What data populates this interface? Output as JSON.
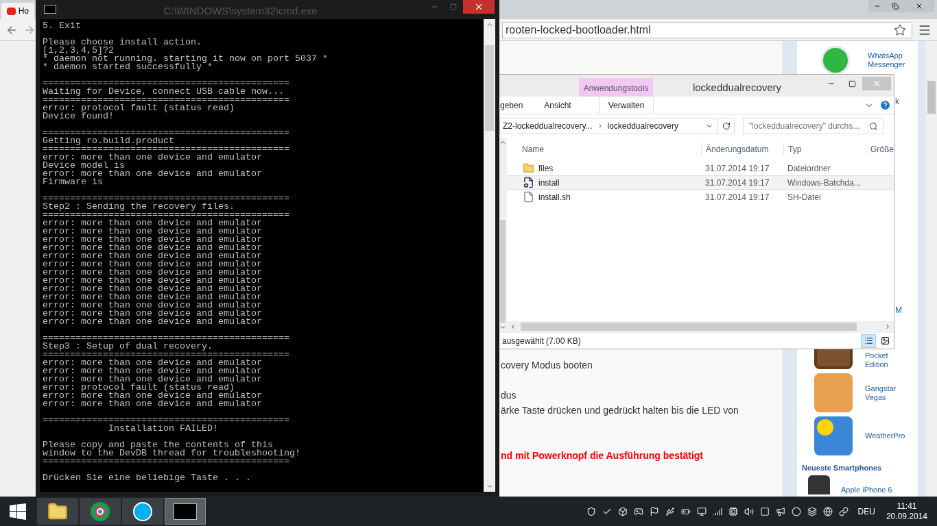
{
  "browser": {
    "tab": {
      "title": "Ho"
    },
    "url": "rooten-locked-bootloader.html",
    "article_lines": [
      {
        "text": "covery Modus booten",
        "kind": "normal"
      },
      {
        "text": "dus",
        "kind": "normal"
      },
      {
        "text": "ärke Taste drücken und gedrückt halten bis die LED von",
        "kind": "normal"
      },
      {
        "text": "nd mit Powerknopf die Ausführung bestätigt",
        "kind": "warning"
      }
    ],
    "sidebar": {
      "top_app": {
        "name": "WhatsApp Messenger"
      },
      "partial_labels": [
        "k",
        "M"
      ],
      "apps": [
        {
          "name": "Pocket Edition",
          "kind": "blocks"
        },
        {
          "name": "Gangstar Vegas",
          "kind": "photo"
        },
        {
          "name": "WeatherPro",
          "kind": "weather"
        }
      ],
      "heading": "Neueste Smartphones",
      "phones": [
        {
          "name": "Apple iPhone 6"
        }
      ]
    }
  },
  "console": {
    "title": "C:\\WINDOWS\\system32\\cmd.exe",
    "blocks": [
      [
        "5. Exit"
      ],
      [
        "Please choose install action.",
        "[1,2,3,4,5]?2",
        "* daemon not running. starting it now on port 5037 *",
        "* daemon started successfully *"
      ],
      [
        "=============================================",
        "Waiting for Device, connect USB cable now...",
        "=============================================",
        "error: protocol fault (status read)",
        "Device found!"
      ],
      [
        "=============================================",
        "Getting ro.build.product",
        "=============================================",
        "error: more than one device and emulator",
        "Device model is",
        "error: more than one device and emulator",
        "Firmware is"
      ],
      [
        "=============================================",
        "Step2 : Sending the recovery files.",
        "=============================================",
        "error: more than one device and emulator",
        "error: more than one device and emulator",
        "error: more than one device and emulator",
        "error: more than one device and emulator",
        "error: more than one device and emulator",
        "error: more than one device and emulator",
        "error: more than one device and emulator",
        "error: more than one device and emulator",
        "error: more than one device and emulator",
        "error: more than one device and emulator",
        "error: more than one device and emulator",
        "error: more than one device and emulator",
        "error: more than one device and emulator"
      ],
      [
        "=============================================",
        "Step3 : Setup of dual recovery.",
        "=============================================",
        "error: more than one device and emulator",
        "error: more than one device and emulator",
        "error: more than one device and emulator",
        "error: protocol fault (status read)",
        "error: more than one device and emulator",
        "error: more than one device and emulator"
      ],
      [
        "=============================================",
        "            Installation FAILED!"
      ],
      [
        "Please copy and paste the contents of this",
        "window to the DevDB thread for troubleshooting!",
        "============================================="
      ],
      [
        "Drücken Sie eine beliebige Taste . . ."
      ]
    ]
  },
  "explorer": {
    "context_tab": "Anwendungstools",
    "title": "lockeddualrecovery",
    "ribbon_tabs": [
      {
        "label": "geben",
        "selected": false
      },
      {
        "label": "Ansicht",
        "selected": false
      },
      {
        "label": "Verwalten",
        "selected": false
      }
    ],
    "breadcrumb": [
      "Z2-lockeddualrecovery...",
      "lockeddualrecovery"
    ],
    "search": {
      "placeholder": "\"lockeddualrecovery\" durchs..."
    },
    "columns": [
      "Name",
      "Änderungsdatum",
      "Typ",
      "Größe"
    ],
    "rows": [
      {
        "name": "files",
        "kind": "folder",
        "date": "31.07.2014 19:17",
        "type": "Dateiordner",
        "selected": false
      },
      {
        "name": "install",
        "kind": "batch",
        "date": "31.07.2014 19:17",
        "type": "Windows-Batchda...",
        "selected": true
      },
      {
        "name": "install.sh",
        "kind": "file",
        "date": "31.07.2014 19:17",
        "type": "SH-Datei",
        "selected": false
      }
    ],
    "status": "ausgewählt (7.00 KB)",
    "views": [
      {
        "kind": "details",
        "selected": true
      },
      {
        "kind": "large",
        "selected": false
      }
    ]
  },
  "taskbar": {
    "apps": [
      {
        "kind": "explorer",
        "selected": false
      },
      {
        "kind": "chrome",
        "selected": false
      },
      {
        "kind": "skype",
        "selected": false
      },
      {
        "kind": "console",
        "selected": true
      }
    ],
    "language": "DEU",
    "time": "11:41",
    "date": "20.09.2014"
  }
}
